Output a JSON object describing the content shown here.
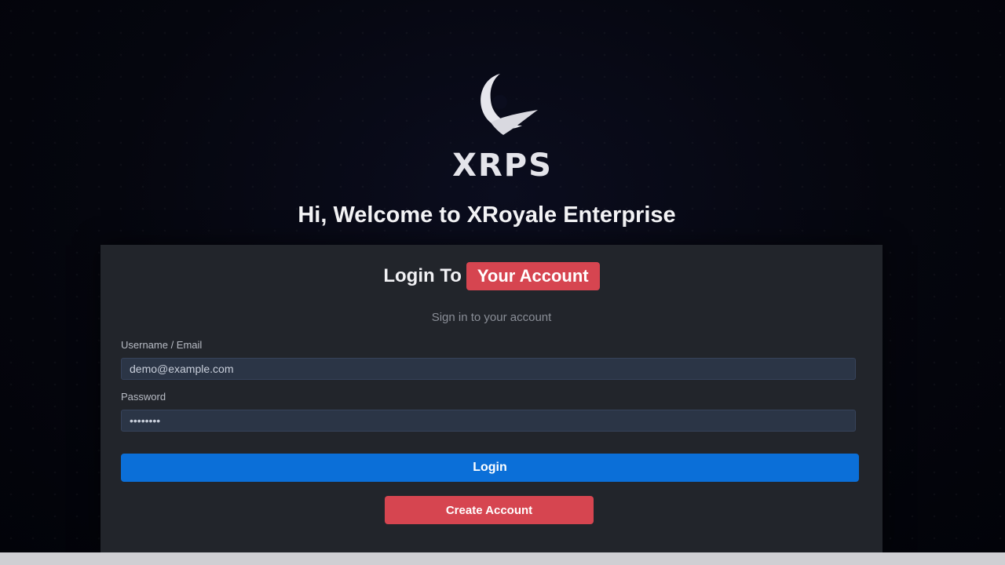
{
  "logo": {
    "icon": "crescent-moon-bird-icon",
    "wordmark": "XRPS"
  },
  "welcome": {
    "text": "Hi, Welcome to XRoyale Enterprise"
  },
  "panel": {
    "title_plain": "Login To",
    "title_highlight": "Your Account",
    "subtitle": "Sign in to your account"
  },
  "form": {
    "username_label": "Username / Email",
    "username_value": "demo@example.com",
    "password_label": "Password",
    "password_value": "password",
    "login_label": "Login",
    "alt_label": "Create Account"
  },
  "colors": {
    "background": "#05060e",
    "panel": "#22252b",
    "field": "#2b3546",
    "primary": "#0b6fd8",
    "accent": "#d64550"
  }
}
